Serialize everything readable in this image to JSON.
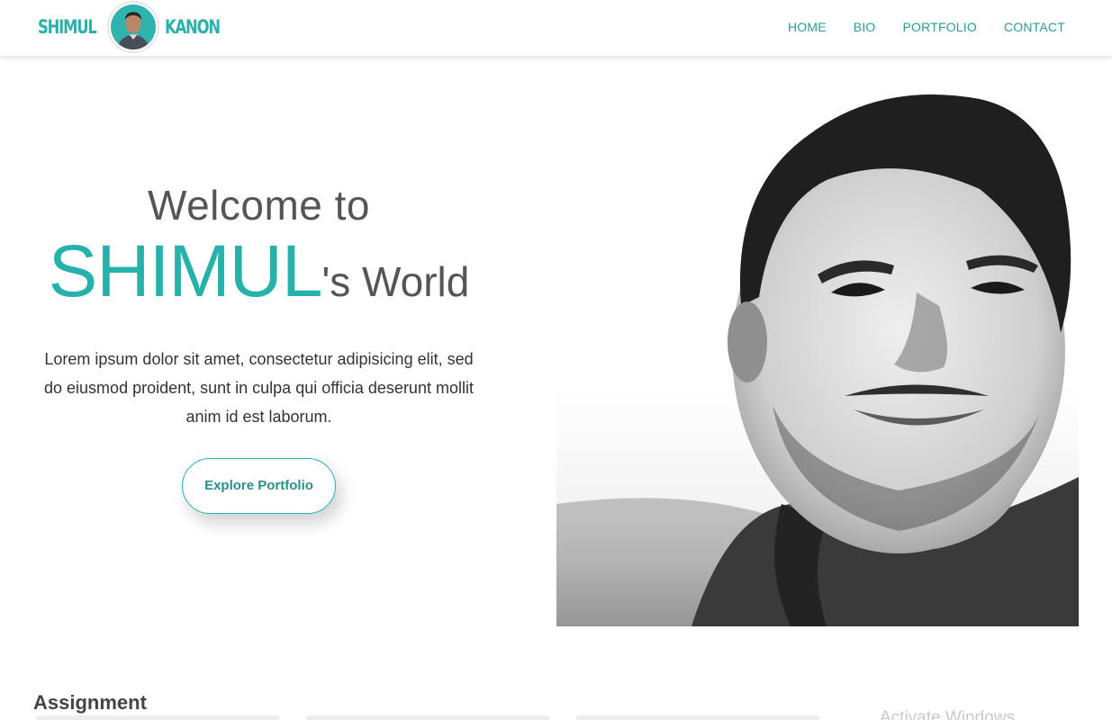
{
  "navbar": {
    "brand_first": "SHIMUL",
    "brand_last": "KANON",
    "links": [
      "HOME",
      "BIO",
      "PORTFOLIO",
      "CONTACT"
    ]
  },
  "hero": {
    "welcome": "Welcome to",
    "name": "SHIMUL",
    "name_suffix": "'s World",
    "description": "Lorem ipsum dolor sit amet, consectetur adipisicing elit, sed do eiusmod proident, sunt in culpa qui officia deserunt mollit anim id est laborum.",
    "cta_label": "Explore Portfolio"
  },
  "section": {
    "title": "Assignment"
  },
  "watermark": {
    "text": "Activate Windows"
  },
  "colors": {
    "accent": "#26b2ab",
    "nav_text": "#2a9d98",
    "heading_text": "#555555"
  },
  "icons": {
    "avatar": "profile-avatar",
    "hero_image": "portrait-photo"
  }
}
